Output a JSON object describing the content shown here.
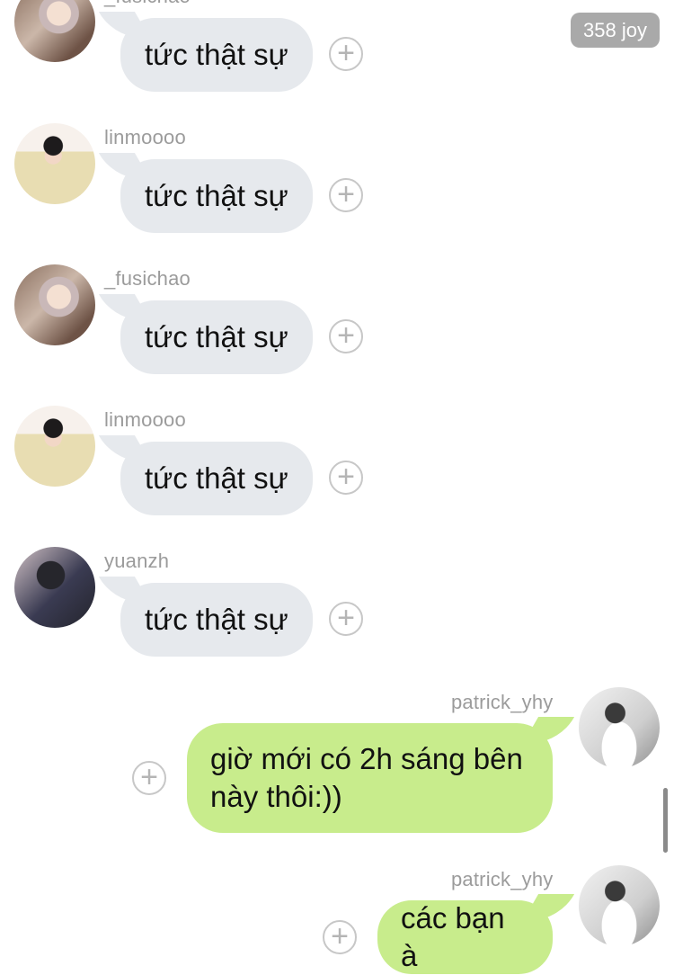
{
  "badge": {
    "label": "358 joy"
  },
  "messages": [
    {
      "sender": "_fusichao",
      "text": "tức thật sự"
    },
    {
      "sender": "linmoooo",
      "text": "tức thật sự"
    },
    {
      "sender": "_fusichao",
      "text": "tức thật sự"
    },
    {
      "sender": "linmoooo",
      "text": "tức thật sự"
    },
    {
      "sender": "yuanzh",
      "text": "tức thật sự"
    },
    {
      "sender": "patrick_yhy",
      "text_line1": "giờ mới có 2h sáng bên",
      "text_line2": "này thôi:))"
    },
    {
      "sender": "patrick_yhy",
      "text": "các bạn à"
    }
  ],
  "icons": {
    "react": "plus-circle-icon"
  }
}
